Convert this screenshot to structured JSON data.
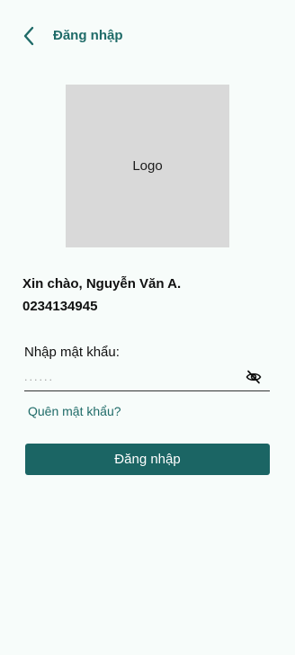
{
  "header": {
    "title": "Đăng nhập",
    "back_icon": "chevron-left-icon"
  },
  "logo": {
    "text": "Logo"
  },
  "user": {
    "greeting": "Xin chào, Nguyễn Văn A.",
    "phone": "0234134945"
  },
  "password": {
    "label": "Nhập mật khẩu:",
    "value": "......",
    "toggle_icon": "eye-slash-icon"
  },
  "links": {
    "forgot": "Quên mật khẩu?"
  },
  "actions": {
    "login_label": "Đăng nhập"
  },
  "colors": {
    "accent": "#1b6564",
    "background": "#f7fcfa",
    "logo_placeholder": "#d9d9d9"
  }
}
